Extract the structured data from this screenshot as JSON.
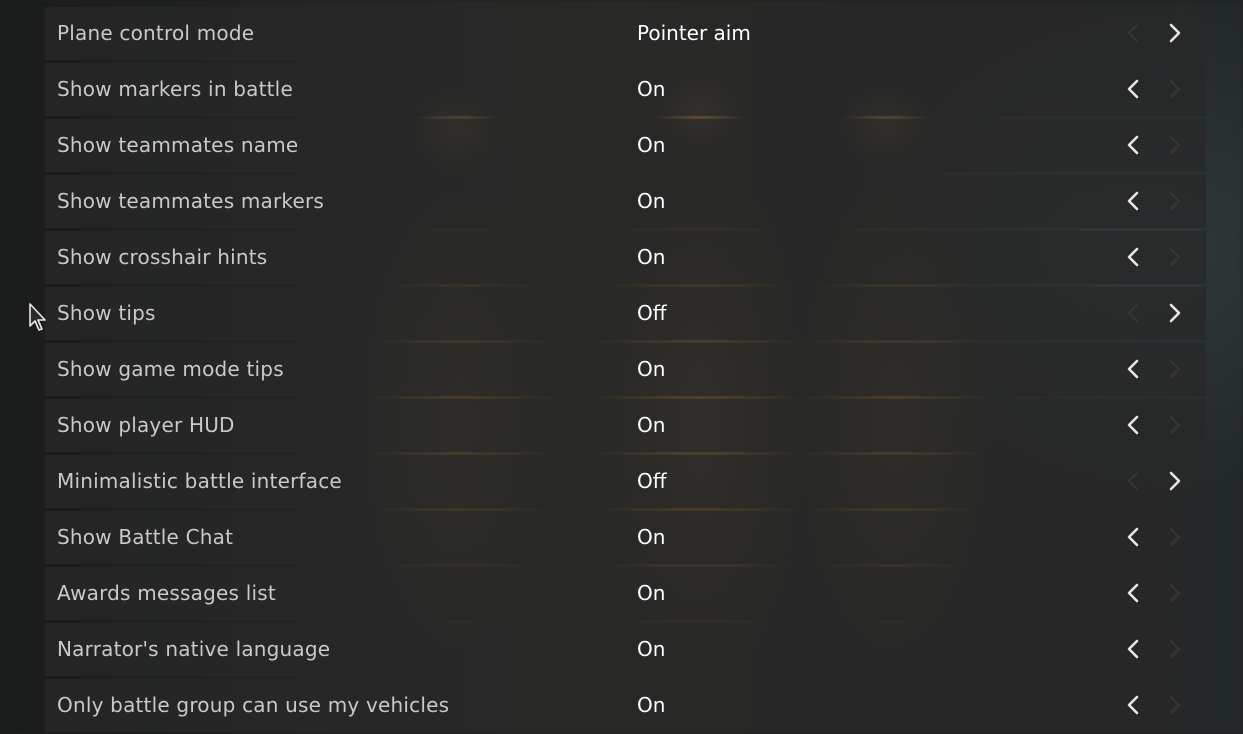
{
  "settings": [
    {
      "label": "Plane control mode",
      "value": "Pointer aim",
      "prev_enabled": false,
      "next_enabled": true
    },
    {
      "label": "Show markers in battle",
      "value": "On",
      "prev_enabled": true,
      "next_enabled": false
    },
    {
      "label": "Show teammates name",
      "value": "On",
      "prev_enabled": true,
      "next_enabled": false
    },
    {
      "label": "Show teammates markers",
      "value": "On",
      "prev_enabled": true,
      "next_enabled": false
    },
    {
      "label": "Show crosshair hints",
      "value": "On",
      "prev_enabled": true,
      "next_enabled": false
    },
    {
      "label": "Show tips",
      "value": "Off",
      "prev_enabled": false,
      "next_enabled": true
    },
    {
      "label": "Show game mode tips",
      "value": "On",
      "prev_enabled": true,
      "next_enabled": false
    },
    {
      "label": "Show player HUD",
      "value": "On",
      "prev_enabled": true,
      "next_enabled": false
    },
    {
      "label": "Minimalistic battle interface",
      "value": "Off",
      "prev_enabled": false,
      "next_enabled": true
    },
    {
      "label": "Show Battle Chat",
      "value": "On",
      "prev_enabled": true,
      "next_enabled": false
    },
    {
      "label": "Awards messages list",
      "value": "On",
      "prev_enabled": true,
      "next_enabled": false
    },
    {
      "label": "Narrator's native language",
      "value": "On",
      "prev_enabled": true,
      "next_enabled": false
    },
    {
      "label": "Only battle group can use my vehicles",
      "value": "On",
      "prev_enabled": true,
      "next_enabled": false
    }
  ],
  "icons": {
    "prev": "chevron-left-icon",
    "next": "chevron-right-icon",
    "cursor": "mouse-pointer-icon"
  },
  "colors": {
    "label": "#c9c9c9",
    "value": "#ffffff",
    "row_background": "#282828"
  }
}
